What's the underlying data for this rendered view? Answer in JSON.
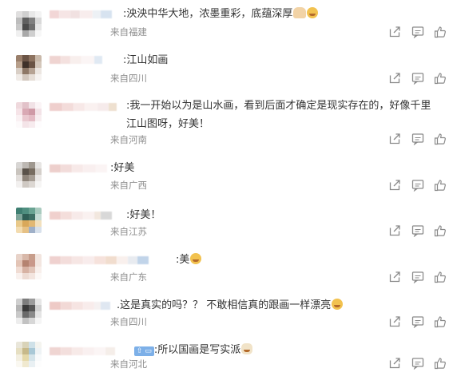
{
  "comments": [
    {
      "text": ":泱泱中华大地，浓墨重彩，底蕴深厚",
      "emojis": [
        "hands",
        "laugh"
      ],
      "location": "来自福建"
    },
    {
      "text": ":江山如画",
      "emojis": [],
      "location": "来自四川"
    },
    {
      "text": ":我一开始以为是山水画，看到后面才确定是现实存在的，好像千里江山图呀，好美！",
      "emojis": [],
      "location": "来自河南"
    },
    {
      "text": ":好美",
      "emojis": [],
      "location": "来自广西"
    },
    {
      "text": ":好美！",
      "emojis": [],
      "location": "来自江苏"
    },
    {
      "text": ":美",
      "emojis": [
        "laugh"
      ],
      "location": "来自广东"
    },
    {
      "text": ".这是真实的吗？？ 不敢相信真的跟画一样漂亮",
      "emojis": [
        "laugh"
      ],
      "location": "来自四川"
    },
    {
      "text": ":所以国画是写实派",
      "emojis": [
        "cat"
      ],
      "location": "来自河北"
    }
  ],
  "icons": {
    "share": "share-icon",
    "reply": "comment-icon",
    "like": "thumbs-up-icon"
  },
  "colors": {
    "text": "#333333",
    "location": "#8e8e8e",
    "icon": "#8a8a8a"
  }
}
